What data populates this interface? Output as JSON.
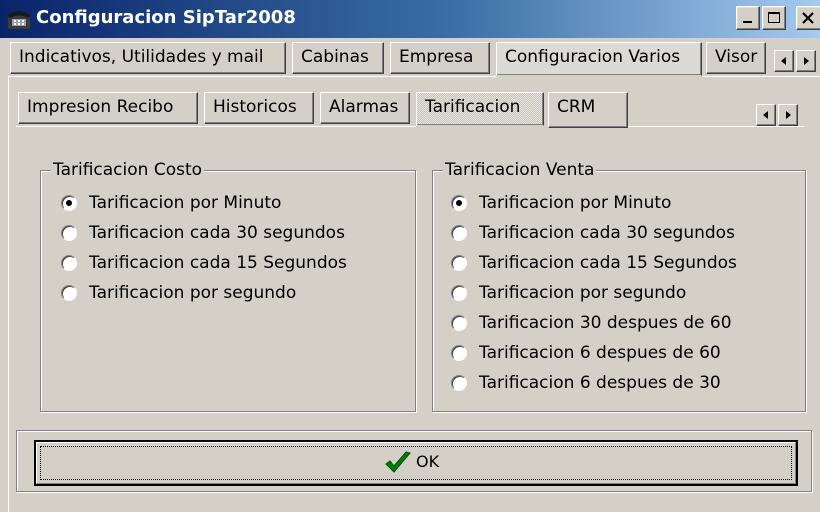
{
  "window": {
    "title": "Configuracion SipTar2008",
    "icons": {
      "app": "telephone-icon",
      "minimize": "minimize-icon",
      "maximize": "maximize-icon",
      "close": "close-icon"
    }
  },
  "top_tabs": [
    {
      "label": "Indicativos, Utilidades y mail",
      "active": false
    },
    {
      "label": "Cabinas",
      "active": false
    },
    {
      "label": "Empresa",
      "active": false
    },
    {
      "label": "Configuracion Varios",
      "active": true
    },
    {
      "label": "Visor",
      "active": false
    }
  ],
  "sub_tabs": [
    {
      "label": "Impresion Recibo",
      "active": false
    },
    {
      "label": "Historicos",
      "active": false
    },
    {
      "label": "Alarmas",
      "active": false
    },
    {
      "label": "Tarificacion",
      "active": true
    },
    {
      "label": "CRM",
      "active": false
    }
  ],
  "groups": {
    "costo": {
      "title": "Tarificacion Costo",
      "options": [
        {
          "label": "Tarificacion por Minuto",
          "checked": true
        },
        {
          "label": "Tarificacion cada 30 segundos",
          "checked": false
        },
        {
          "label": "Tarificacion cada 15 Segundos",
          "checked": false
        },
        {
          "label": "Tarificacion por segundo",
          "checked": false
        }
      ]
    },
    "venta": {
      "title": "Tarificacion Venta",
      "options": [
        {
          "label": "Tarificacion por Minuto",
          "checked": true
        },
        {
          "label": "Tarificacion cada 30 segundos",
          "checked": false
        },
        {
          "label": "Tarificacion cada 15 Segundos",
          "checked": false
        },
        {
          "label": "Tarificacion por segundo",
          "checked": false
        },
        {
          "label": "Tarificacion 30 despues de 60",
          "checked": false
        },
        {
          "label": "Tarificacion 6 despues de 60",
          "checked": false
        },
        {
          "label": "Tarificacion 6 despues de 30",
          "checked": false
        }
      ]
    }
  },
  "ok_button": {
    "label": "OK",
    "icon": "checkmark-icon"
  },
  "colors": {
    "titlebar_start": "#0a246a",
    "titlebar_end": "#a6caf0",
    "face": "#d4d0c8",
    "check": "#008000"
  }
}
